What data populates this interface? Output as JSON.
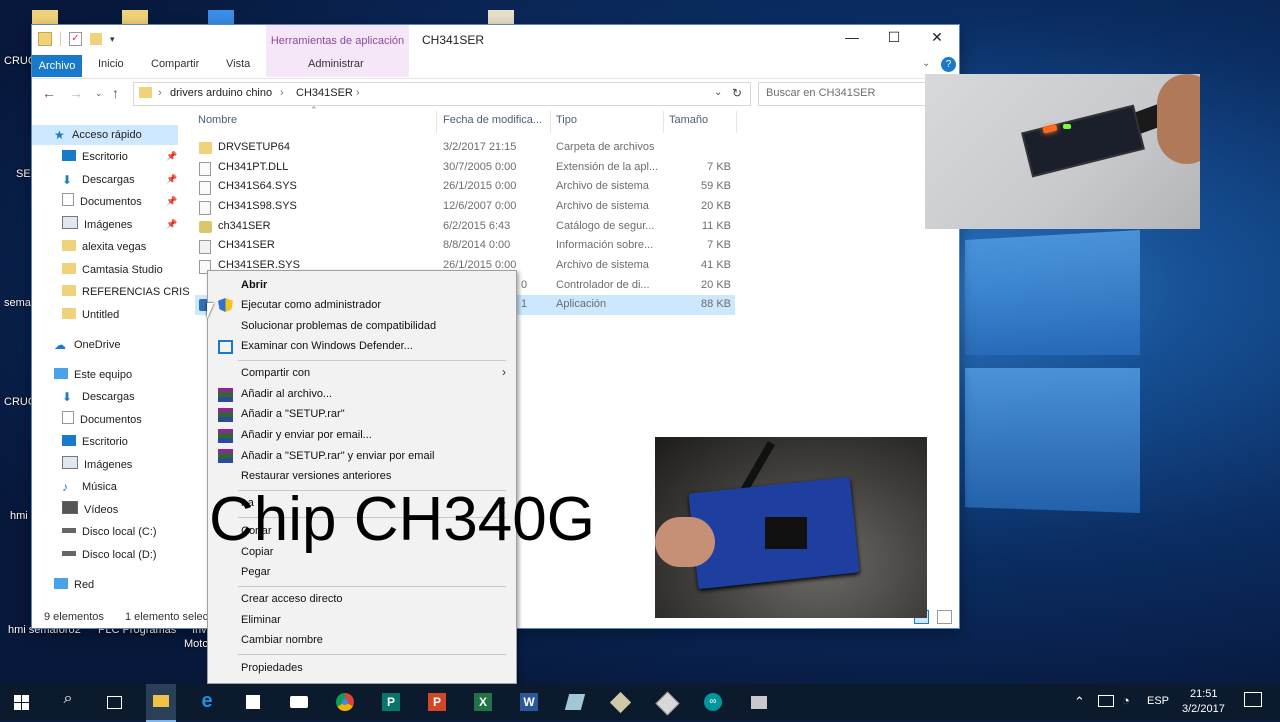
{
  "desktop": {
    "labels": [
      "CRUC",
      "SEN",
      "sema",
      "CRUC",
      "hmi",
      "hmi semaforo2",
      "PLC Programas",
      "Inv",
      "Moto"
    ]
  },
  "window": {
    "context_tab": "Herramientas de aplicación",
    "title": "CH341SER",
    "ribbon_tabs": [
      "Archivo",
      "Inicio",
      "Compartir",
      "Vista",
      "Administrar"
    ],
    "breadcrumb": [
      "drivers arduino chino",
      "CH341SER"
    ],
    "search_placeholder": "Buscar en CH341SER",
    "sidebar": [
      {
        "label": "Acceso rápido",
        "icon": "star-icon"
      },
      {
        "label": "Escritorio",
        "icon": "desktop-icon"
      },
      {
        "label": "Descargas",
        "icon": "download-icon"
      },
      {
        "label": "Documentos",
        "icon": "document-icon"
      },
      {
        "label": "Imágenes",
        "icon": "image-icon"
      },
      {
        "label": "alexita vegas",
        "icon": "folder-icon"
      },
      {
        "label": "Camtasia Studio",
        "icon": "folder-icon"
      },
      {
        "label": "REFERENCIAS CRIS",
        "icon": "folder-icon"
      },
      {
        "label": "Untitled",
        "icon": "folder-icon"
      },
      {
        "label": "OneDrive",
        "icon": "cloud-icon"
      },
      {
        "label": "Este equipo",
        "icon": "computer-icon"
      },
      {
        "label": "Descargas",
        "icon": "download-icon"
      },
      {
        "label": "Documentos",
        "icon": "document-icon"
      },
      {
        "label": "Escritorio",
        "icon": "desktop-icon"
      },
      {
        "label": "Imágenes",
        "icon": "image-icon"
      },
      {
        "label": "Música",
        "icon": "music-icon"
      },
      {
        "label": "Vídeos",
        "icon": "video-icon"
      },
      {
        "label": "Disco local (C:)",
        "icon": "drive-icon"
      },
      {
        "label": "Disco local (D:)",
        "icon": "drive-icon"
      },
      {
        "label": "Red",
        "icon": "network-icon"
      }
    ],
    "columns": [
      "Nombre",
      "Fecha de modifica...",
      "Tipo",
      "Tamaño"
    ],
    "files": [
      {
        "name": "DRVSETUP64",
        "date": "3/2/2017 21:15",
        "type": "Carpeta de archivos",
        "size": ""
      },
      {
        "name": "CH341PT.DLL",
        "date": "30/7/2005 0:00",
        "type": "Extensión de la apl...",
        "size": "7 KB"
      },
      {
        "name": "CH341S64.SYS",
        "date": "26/1/2015 0:00",
        "type": "Archivo de sistema",
        "size": "59 KB"
      },
      {
        "name": "CH341S98.SYS",
        "date": "12/6/2007 0:00",
        "type": "Archivo de sistema",
        "size": "20 KB"
      },
      {
        "name": "ch341SER",
        "date": "6/2/2015 6:43",
        "type": "Catálogo de segur...",
        "size": "11 KB"
      },
      {
        "name": "CH341SER",
        "date": "8/8/2014 0:00",
        "type": "Información sobre...",
        "size": "7 KB"
      },
      {
        "name": "CH341SER.SYS",
        "date": "26/1/2015 0:00",
        "type": "Archivo de sistema",
        "size": "41 KB"
      },
      {
        "name": "",
        "date": "0",
        "type": "Controlador de di...",
        "size": "20 KB"
      },
      {
        "name": "",
        "date": "1",
        "type": "Aplicación",
        "size": "88 KB"
      }
    ],
    "status_count": "9 elementos",
    "status_selected": "1 elemento selec"
  },
  "context_menu": {
    "items": [
      {
        "label": "Abrir",
        "bold": true,
        "icon": ""
      },
      {
        "label": "Ejecutar como administrador",
        "icon": "shield-icon"
      },
      {
        "label": "Solucionar problemas de compatibilidad",
        "icon": ""
      },
      {
        "label": "Examinar con Windows Defender...",
        "icon": "defender-icon"
      },
      {
        "label": "Compartir con",
        "icon": "",
        "submenu": true
      },
      {
        "label": "Añadir al archivo...",
        "icon": "winrar-icon"
      },
      {
        "label": "Añadir a \"SETUP.rar\"",
        "icon": "winrar-icon"
      },
      {
        "label": "Añadir y enviar por email...",
        "icon": "winrar-icon"
      },
      {
        "label": "Añadir a \"SETUP.rar\" y enviar por email",
        "icon": "winrar-icon"
      },
      {
        "label": "Restaurar versiones anteriores",
        "icon": ""
      },
      {
        "label": "r a",
        "icon": "",
        "submenu": true
      },
      {
        "label": "Cortar",
        "icon": ""
      },
      {
        "label": "Copiar",
        "icon": ""
      },
      {
        "label": "Pegar",
        "icon": ""
      },
      {
        "label": "Crear acceso directo",
        "icon": ""
      },
      {
        "label": "Eliminar",
        "icon": ""
      },
      {
        "label": "Cambiar nombre",
        "icon": ""
      },
      {
        "label": "Propiedades",
        "icon": ""
      }
    ]
  },
  "overlay_caption": "Chip CH340G",
  "taskbar": {
    "icons": [
      "windows-start-icon",
      "search-icon",
      "task-view-icon",
      "file-explorer-icon",
      "edge-icon",
      "store-icon",
      "camera-icon",
      "chrome-icon",
      "publisher-icon",
      "powerpoint-icon",
      "excel-icon",
      "word-icon",
      "app-icon",
      "app-icon",
      "app-icon",
      "arduino-icon",
      "app-icon"
    ],
    "language": "ESP",
    "time": "21:51",
    "date": "3/2/2017"
  },
  "colors": {
    "accent": "#1979ca",
    "selection": "#cce8ff",
    "context_tab_bg": "#f6e7f8",
    "taskbar": "#0b1a2c"
  }
}
